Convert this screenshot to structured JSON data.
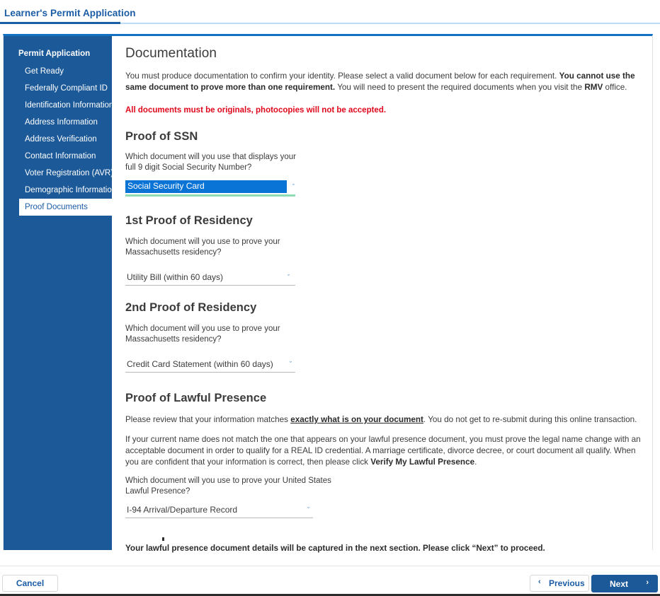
{
  "header": {
    "title": "Learner's Permit Application",
    "accent": "#1a5ca5",
    "rail_color": "#bcdcf5"
  },
  "sidebar": {
    "heading": "Permit Application",
    "bg": "#1c5998",
    "items": [
      {
        "label": "Get Ready",
        "active": false
      },
      {
        "label": "Federally Compliant ID",
        "active": false
      },
      {
        "label": "Identification Information",
        "active": false
      },
      {
        "label": "Address Information",
        "active": false
      },
      {
        "label": "Address Verification",
        "active": false
      },
      {
        "label": "Contact Information",
        "active": false
      },
      {
        "label": "Voter Registration (AVR)",
        "active": false
      },
      {
        "label": "Demographic Information",
        "active": false
      },
      {
        "label": "Proof Documents",
        "active": true
      }
    ]
  },
  "main": {
    "page_title": "Documentation",
    "intro": {
      "part1": "You must produce documentation to confirm your identity. Please select a valid document below for each requirement. ",
      "bold1": "You cannot use the same document to prove more than one requirement.",
      "part2": " You will need to present the required documents when you visit the ",
      "bold2": "RMV",
      "part3": " office."
    },
    "alert": "All documents must be originals, photocopies will not be accepted.",
    "alert_color": "#e2071c",
    "sections": [
      {
        "title": "Proof of SSN",
        "question_line1": "Which document will you use that displays your",
        "question_line2": "full 9 digit Social Security Number?",
        "selected_value": "Social Security Card",
        "focused": true
      },
      {
        "title": "1st Proof of Residency",
        "question_line1": "Which document will you use to prove your",
        "question_line2": "Massachusetts residency?",
        "selected_value": "Utility Bill (within 60 days)",
        "focused": false
      },
      {
        "title": "2nd Proof of Residency",
        "question_line1": "Which document will you use to prove your",
        "question_line2": "Massachusetts residency?",
        "selected_value": "Credit Card Statement (within 60 days)",
        "focused": false
      }
    ],
    "lawful": {
      "title": "Proof of Lawful Presence",
      "para1_part1": "Please review that your information matches ",
      "para1_underlined": "exactly what is on your document",
      "para1_part2": ". You do not get to re-submit during this online transaction.",
      "para2_part1": "If your current name does not match the one that appears on your lawful presence document, you must prove the legal name change with an acceptable document in order to qualify for a REAL ID credential. A marriage certificate, divorce decree, or court document all qualify. When you are confident that your information is correct, then please click ",
      "para2_bold": "Verify My Lawful Presence",
      "para2_part3": ".",
      "question_line1": "Which document will you use to prove your United States",
      "question_line2": "Lawful Presence?",
      "selected_value": "I-94 Arrival/Departure Record",
      "note": "Your lawful presence document details will be captured in the next section. Please click “Next” to proceed."
    }
  },
  "footer": {
    "cancel_label": "Cancel",
    "previous_label": "Previous",
    "next_label": "Next",
    "prev_arrow": "‹",
    "next_arrow": "›",
    "primary_color": "#1c5998",
    "link_color": "#1a5ca5"
  },
  "icons": {
    "chevron_down": "ˇ"
  }
}
